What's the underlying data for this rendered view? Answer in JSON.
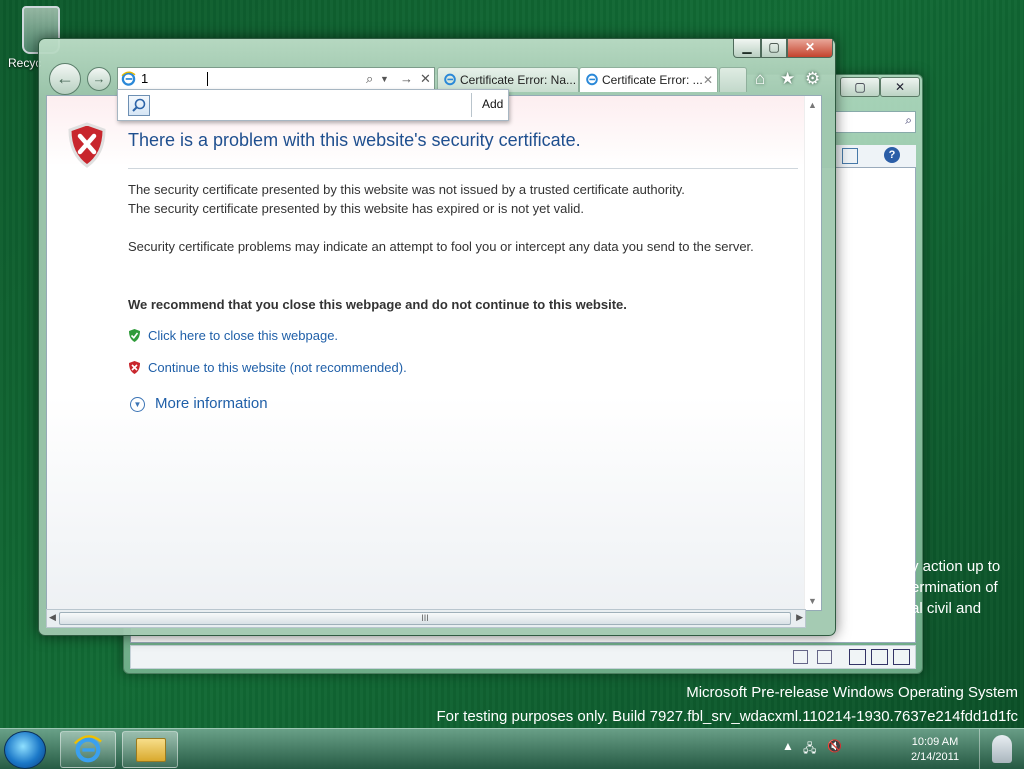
{
  "desktop": {
    "recycle_bin_label": "Recyc",
    "back_window_text_lines": [
      "y action up to",
      "ermination of",
      "al civil and"
    ]
  },
  "browser": {
    "address_value": "1",
    "dropdown_add_label": "Add",
    "tabs": [
      {
        "label": "Certificate Error: Na...",
        "active": false
      },
      {
        "label": "Certificate Error: ...",
        "active": true
      }
    ],
    "scroll_grip": "III"
  },
  "page": {
    "title": "There is a problem with this website's security certificate.",
    "line1": "The security certificate presented by this website was not issued by a trusted certificate authority.",
    "line2": "The security certificate presented by this website has expired or is not yet valid.",
    "line3": "Security certificate problems may indicate an attempt to fool you or intercept any data you send to the server.",
    "recommend": "We recommend that you close this webpage and do not continue to this website.",
    "close_link": "Click here to close this webpage.",
    "continue_link": "Continue to this website (not recommended).",
    "more_info": "More information"
  },
  "watermark": {
    "line1": "Microsoft Pre-release Windows Operating System",
    "line2": "For testing purposes only. Build 7927.fbl_srv_wdacxml.110214-1930.7637e214fdd1d1fc"
  },
  "taskbar": {
    "time": "10:09 AM",
    "date": "2/14/2011"
  },
  "colors": {
    "link": "#1f5fa8",
    "title": "#1f4f8f",
    "desktop_green": "#126b35"
  }
}
